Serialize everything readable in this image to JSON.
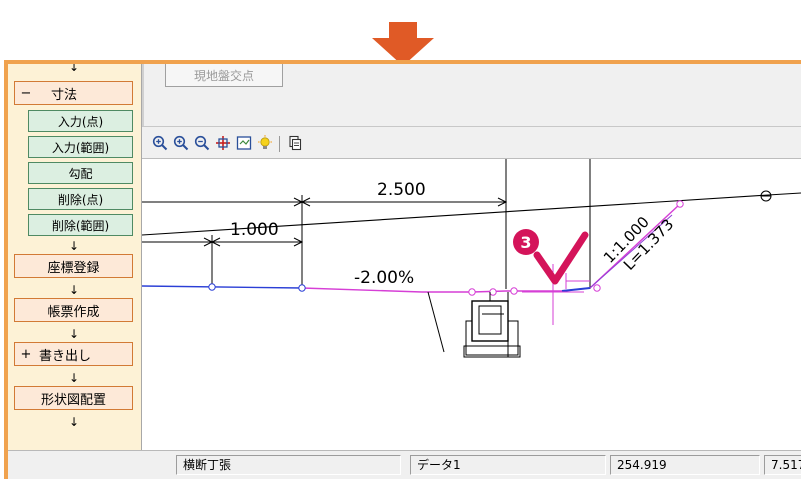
{
  "colors": {
    "arrow": "#e05a26",
    "app_border": "#f0a24e",
    "profile_line": "#d63fd6",
    "ground_line": "#2b3fd6",
    "badge": "#d4145a",
    "check": "#d4145a"
  },
  "top_panel": {
    "button_label": "現地盤交点"
  },
  "sidebar": {
    "items": [
      {
        "sign": "−",
        "label": "寸法",
        "kind": "group"
      },
      {
        "label": "入力(点)",
        "kind": "sub"
      },
      {
        "label": "入力(範囲)",
        "kind": "sub"
      },
      {
        "label": "勾配",
        "kind": "sub"
      },
      {
        "label": "削除(点)",
        "kind": "sub"
      },
      {
        "label": "削除(範囲)",
        "kind": "sub"
      },
      {
        "label": "座標登録",
        "kind": "main"
      },
      {
        "label": "帳票作成",
        "kind": "main"
      },
      {
        "sign": "+",
        "label": "書き出し",
        "kind": "group"
      },
      {
        "label": "形状図配置",
        "kind": "main"
      }
    ],
    "down_glyph": "↓"
  },
  "toolbar": {
    "icons": [
      "zoom-in-icon",
      "zoom-in-alt-icon",
      "zoom-out-icon",
      "pan-icon",
      "zoom-fit-icon",
      "light-bulb-icon",
      "copy-icon"
    ]
  },
  "drawing": {
    "dim_top": "2.500",
    "dim_mid": "1.000",
    "slope_text": "-2.00%",
    "ratio_text": "1:1.000",
    "length_text": "L=1.373",
    "badge": "3"
  },
  "status": {
    "cell1": "横断丁張",
    "cell2": "データ1",
    "cell3": "254.919",
    "cell4": "7.517"
  }
}
